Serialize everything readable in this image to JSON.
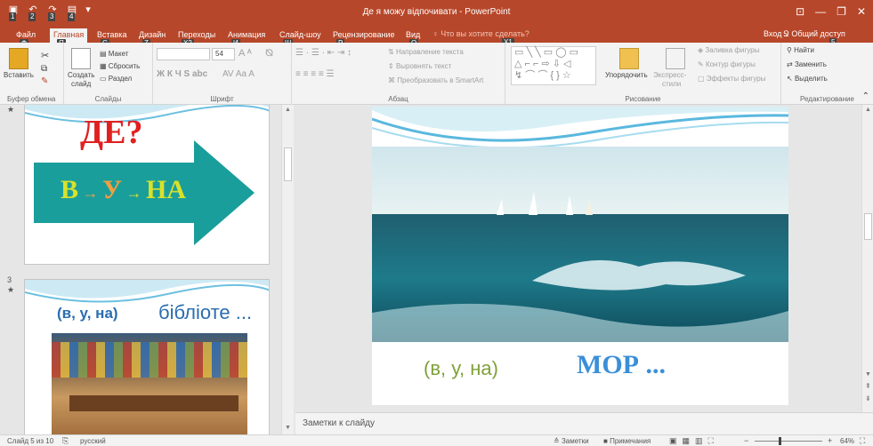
{
  "window": {
    "title": "Де я можу відпочивати - PowerPoint",
    "qat_keys": [
      "1",
      "2",
      "3",
      "4"
    ]
  },
  "tabs": [
    {
      "label": "Файл",
      "key": "Ф"
    },
    {
      "label": "Главная",
      "key": "Я"
    },
    {
      "label": "Вставка",
      "key": "С"
    },
    {
      "label": "Дизайн",
      "key": "Z"
    },
    {
      "label": "Переходы",
      "key": "X2"
    },
    {
      "label": "Анимация",
      "key": "И"
    },
    {
      "label": "Слайд-шоу",
      "key": "Ш"
    },
    {
      "label": "Рецензирование",
      "key": "Р"
    },
    {
      "label": "Вид",
      "key": "О"
    }
  ],
  "tell_me": "Что вы хотите сделать?",
  "tell_me_key": "Х1",
  "sign_in": "Вход",
  "share": "Общий доступ",
  "share_key": "5",
  "ribbon": {
    "clipboard": {
      "paste": "Вставить",
      "label": "Буфер обмена"
    },
    "slides": {
      "layout": "Макет",
      "reset": "Сбросить",
      "new_slide_1": "Создать",
      "new_slide_2": "слайд",
      "section": "Раздел",
      "label": "Слайды"
    },
    "font": {
      "size": "54",
      "label": "Шрифт",
      "styles": "Ж  К  Ч  S  abc"
    },
    "paragraph": {
      "text_direction": "Направление текста",
      "align_text": "Выровнять текст",
      "smartart": "Преобразовать в SmartArt",
      "label": "Абзац"
    },
    "drawing": {
      "arrange": "Упорядочить",
      "quick_styles_1": "Экспресс-",
      "quick_styles_2": "стили",
      "shape_fill": "Заливка фигуры",
      "shape_outline": "Контур фигуры",
      "shape_effects": "Эффекты фигуры",
      "label": "Рисование"
    },
    "editing": {
      "find": "Найти",
      "replace": "Заменить",
      "select": "Выделить",
      "label": "Редактирование"
    }
  },
  "thumbnails": {
    "slide_a": {
      "question": "ДЕ?",
      "letters": [
        "В",
        "У",
        "НА"
      ]
    },
    "slide_b": {
      "number": "3",
      "prepositions": "(в,  у,  на)",
      "word": "бібліоте ..."
    }
  },
  "current_slide": {
    "prepositions": "(в,  у,  на)",
    "word": "МОР ..."
  },
  "notes_placeholder": "Заметки к слайду",
  "status": {
    "slide_info": "Слайд 5 из 10",
    "language": "русский",
    "notes": "Заметки",
    "comments": "Примечания",
    "zoom": "64%"
  },
  "colors": {
    "accent": "#b7472a",
    "arrow": "#1a9e9b",
    "red_text": "#e02020",
    "yellow_text": "#d8e22a",
    "green_text": "#7fa13a",
    "blue_text": "#3a8fd8"
  }
}
